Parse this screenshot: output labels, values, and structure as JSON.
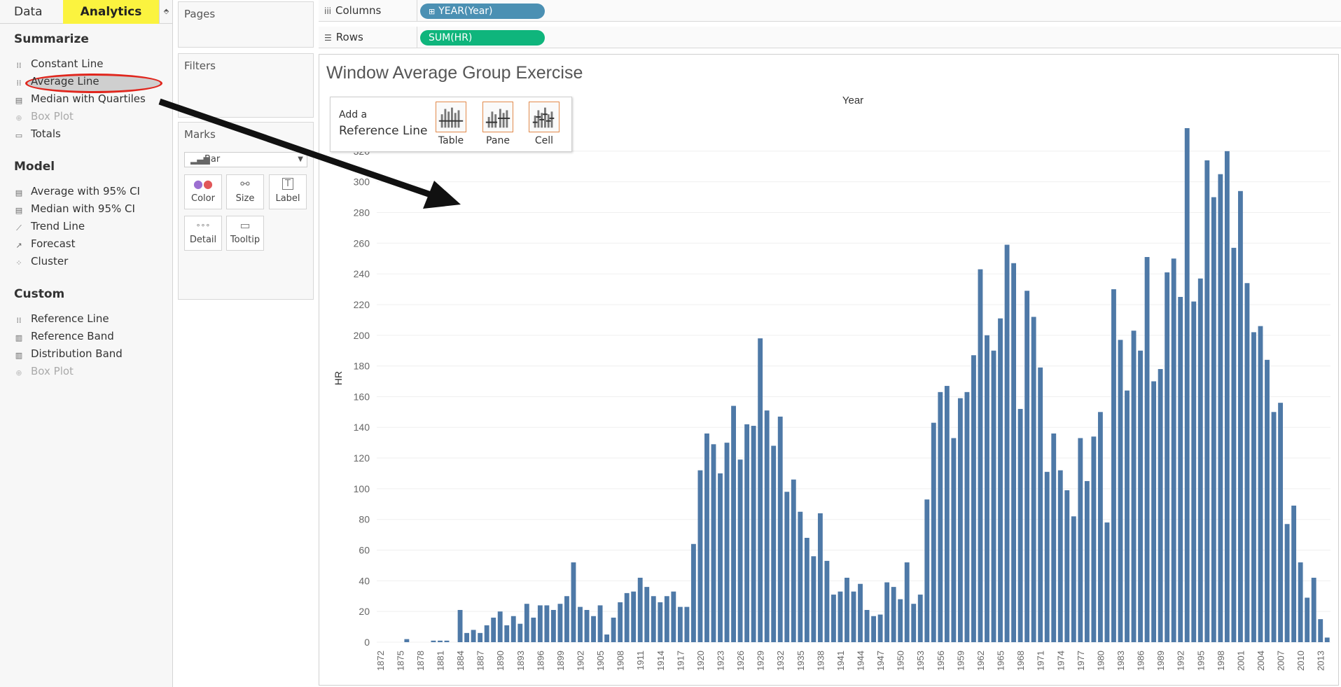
{
  "tabs": {
    "data": "Data",
    "analytics": "Analytics",
    "arrow": "⬘"
  },
  "analytics": {
    "summarize": {
      "title": "Summarize",
      "items": [
        {
          "label": "Constant Line",
          "icon": "constant-line-icon",
          "disabled": false
        },
        {
          "label": "Average Line",
          "icon": "average-line-icon",
          "disabled": false
        },
        {
          "label": "Median with Quartiles",
          "icon": "median-quartiles-icon",
          "disabled": false
        },
        {
          "label": "Box Plot",
          "icon": "box-plot-icon",
          "disabled": true
        },
        {
          "label": "Totals",
          "icon": "totals-icon",
          "disabled": false
        }
      ]
    },
    "model": {
      "title": "Model",
      "items": [
        {
          "label": "Average with 95% CI",
          "icon": "average-ci-icon",
          "disabled": false
        },
        {
          "label": "Median with 95% CI",
          "icon": "median-ci-icon",
          "disabled": false
        },
        {
          "label": "Trend Line",
          "icon": "trend-line-icon",
          "disabled": false
        },
        {
          "label": "Forecast",
          "icon": "forecast-icon",
          "disabled": false
        },
        {
          "label": "Cluster",
          "icon": "cluster-icon",
          "disabled": false
        }
      ]
    },
    "custom": {
      "title": "Custom",
      "items": [
        {
          "label": "Reference Line",
          "icon": "reference-line-icon",
          "disabled": false
        },
        {
          "label": "Reference Band",
          "icon": "reference-band-icon",
          "disabled": false
        },
        {
          "label": "Distribution Band",
          "icon": "distribution-band-icon",
          "disabled": false
        },
        {
          "label": "Box Plot",
          "icon": "box-plot-icon",
          "disabled": true
        }
      ]
    }
  },
  "cards": {
    "pages": "Pages",
    "filters": "Filters",
    "marks": {
      "title": "Marks",
      "type": "Bar",
      "buttons": [
        "Color",
        "Size",
        "Label",
        "Detail",
        "Tooltip"
      ]
    }
  },
  "shelves": {
    "columns": {
      "label": "Columns",
      "pill": "YEAR(Year)"
    },
    "rows": {
      "label": "Rows",
      "pill": "SUM(HR)"
    }
  },
  "sheet": {
    "title": "Window Average Group Exercise"
  },
  "ref_popup": {
    "add": "Add a",
    "title": "Reference Line",
    "options": [
      "Table",
      "Pane",
      "Cell"
    ]
  },
  "colors": {
    "bar": "#4e79a7",
    "accent": "#fbf33f",
    "columns_pill": "#4b90b3",
    "rows_pill": "#0fb57c",
    "highlight": "#e0261d"
  },
  "chart_data": {
    "type": "bar",
    "title": "Window Average Group Exercise",
    "xlabel": "Year",
    "ylabel": "HR",
    "ylim": [
      0,
      340
    ],
    "yticks": [
      0,
      20,
      40,
      60,
      80,
      100,
      120,
      140,
      160,
      180,
      200,
      220,
      240,
      260,
      280,
      300,
      320
    ],
    "grid": true,
    "x_start": 1872,
    "x_end": 2014,
    "xtick_labels": [
      "1872",
      "1875",
      "1878",
      "1881",
      "1884",
      "1887",
      "1890",
      "1893",
      "1896",
      "1899",
      "1902",
      "1905",
      "1908",
      "1911",
      "1914",
      "1917",
      "1920",
      "1923",
      "1926",
      "1929",
      "1932",
      "1935",
      "1938",
      "1941",
      "1944",
      "1947",
      "1950",
      "1953",
      "1956",
      "1959",
      "1962",
      "1965",
      "1968",
      "1971",
      "1974",
      "1977",
      "1980",
      "1983",
      "1986",
      "1989",
      "1992",
      "1995",
      "1998",
      "2001",
      "2004",
      "2007",
      "2010",
      "2013"
    ],
    "values": [
      0,
      0,
      0,
      0,
      2,
      0,
      0,
      0,
      1,
      1,
      1,
      0,
      21,
      6,
      8,
      6,
      11,
      16,
      20,
      11,
      17,
      12,
      25,
      16,
      24,
      24,
      21,
      25,
      30,
      52,
      23,
      21,
      17,
      24,
      5,
      16,
      26,
      32,
      33,
      42,
      36,
      30,
      26,
      30,
      33,
      23,
      23,
      64,
      112,
      136,
      129,
      110,
      130,
      154,
      119,
      142,
      141,
      198,
      151,
      128,
      147,
      98,
      106,
      85,
      68,
      56,
      84,
      53,
      31,
      33,
      42,
      33,
      38,
      21,
      17,
      18,
      39,
      36,
      28,
      52,
      25,
      31,
      93,
      143,
      163,
      167,
      133,
      159,
      163,
      187,
      243,
      200,
      190,
      211,
      259,
      247,
      152,
      229,
      212,
      179,
      111,
      136,
      112,
      99,
      82,
      133,
      105,
      134,
      150,
      78,
      230,
      197,
      164,
      203,
      190,
      251,
      170,
      178,
      241,
      250,
      225,
      335,
      222,
      237,
      314,
      290,
      305,
      320,
      257,
      294,
      234,
      202,
      206,
      184,
      150,
      156,
      77,
      89,
      52,
      29,
      42,
      15,
      3
    ]
  }
}
